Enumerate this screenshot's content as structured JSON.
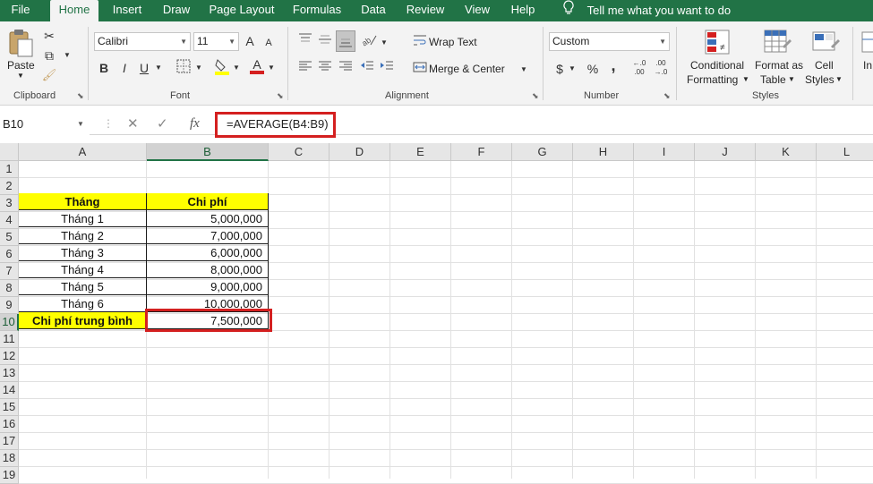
{
  "tabs": [
    "File",
    "Home",
    "Insert",
    "Draw",
    "Page Layout",
    "Formulas",
    "Data",
    "Review",
    "View",
    "Help"
  ],
  "active_tab": "Home",
  "tell_me": "Tell me what you want to do",
  "ribbon": {
    "clipboard": {
      "paste": "Paste",
      "label": "Clipboard"
    },
    "font": {
      "name": "Calibri",
      "size": "11",
      "grow": "A",
      "shrink": "A",
      "bold": "B",
      "italic": "I",
      "underline": "U",
      "fill_color_letter": "",
      "font_color_letter": "A",
      "label": "Font"
    },
    "alignment": {
      "wrap_text": "Wrap Text",
      "merge_center": "Merge & Center",
      "label": "Alignment"
    },
    "number": {
      "format": "Custom",
      "currency": "$",
      "percent": "%",
      "comma": ",",
      "inc_decimal": "←.0 .00",
      "dec_decimal": ".00 →.0",
      "label": "Number"
    },
    "styles": {
      "conditional_1": "Conditional",
      "conditional_2": "Formatting",
      "format_table_1": "Format as",
      "format_table_2": "Table",
      "cell_styles_1": "Cell",
      "cell_styles_2": "Styles",
      "label": "Styles"
    },
    "cells_partial": "In"
  },
  "formula_bar": {
    "name_box": "B10",
    "cancel": "✕",
    "enter": "✓",
    "fx": "fx",
    "formula": "=AVERAGE(B4:B9)"
  },
  "columns": [
    "A",
    "B",
    "C",
    "D",
    "E",
    "F",
    "G",
    "H",
    "I",
    "J",
    "K",
    "L"
  ],
  "rows": [
    "1",
    "2",
    "3",
    "4",
    "5",
    "6",
    "7",
    "8",
    "9",
    "10",
    "11",
    "12",
    "13",
    "14",
    "15",
    "16",
    "17",
    "18",
    "19"
  ],
  "selected_cell": "B10",
  "sheet": {
    "header": {
      "a": "Tháng",
      "b": "Chi phí"
    },
    "data": [
      {
        "a": "Tháng 1",
        "b": "5,000,000"
      },
      {
        "a": "Tháng 2",
        "b": "7,000,000"
      },
      {
        "a": "Tháng 3",
        "b": "6,000,000"
      },
      {
        "a": "Tháng 4",
        "b": "8,000,000"
      },
      {
        "a": "Tháng 5",
        "b": "9,000,000"
      },
      {
        "a": "Tháng 6",
        "b": "10,000,000"
      }
    ],
    "total": {
      "a": "Chi phí trung bình",
      "b": "7,500,000"
    }
  },
  "colors": {
    "excel_green": "#217346",
    "highlight_yellow": "#ffff00",
    "annotation_red": "#d42020"
  }
}
